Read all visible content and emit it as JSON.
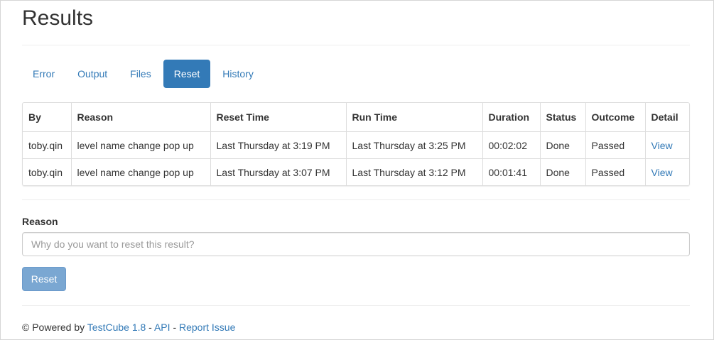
{
  "page": {
    "title": "Results"
  },
  "tabs": [
    {
      "label": "Error",
      "active": false
    },
    {
      "label": "Output",
      "active": false
    },
    {
      "label": "Files",
      "active": false
    },
    {
      "label": "Reset",
      "active": true
    },
    {
      "label": "History",
      "active": false
    }
  ],
  "table": {
    "headers": [
      "By",
      "Reason",
      "Reset Time",
      "Run Time",
      "Duration",
      "Status",
      "Outcome",
      "Detail"
    ],
    "rows": [
      [
        "toby.qin",
        "level name change pop up",
        "Last Thursday at 3:19 PM",
        "Last Thursday at 3:25 PM",
        "00:02:02",
        "Done",
        "Passed",
        "View"
      ],
      [
        "toby.qin",
        "level name change pop up",
        "Last Thursday at 3:07 PM",
        "Last Thursday at 3:12 PM",
        "00:01:41",
        "Done",
        "Passed",
        "View"
      ]
    ]
  },
  "form": {
    "reason_label": "Reason",
    "reason_placeholder": "Why do you want to reset this result?",
    "reason_value": "",
    "reset_button_label": "Reset"
  },
  "footer": {
    "copyright": "© Powered by",
    "product_link": "TestCube 1.8",
    "sep1": "-",
    "api_link": "API",
    "sep2": "-",
    "report_link": "Report Issue"
  },
  "colors": {
    "accent": "#337ab7",
    "button_disabled": "#7aa7d2",
    "border": "#dddddd"
  }
}
